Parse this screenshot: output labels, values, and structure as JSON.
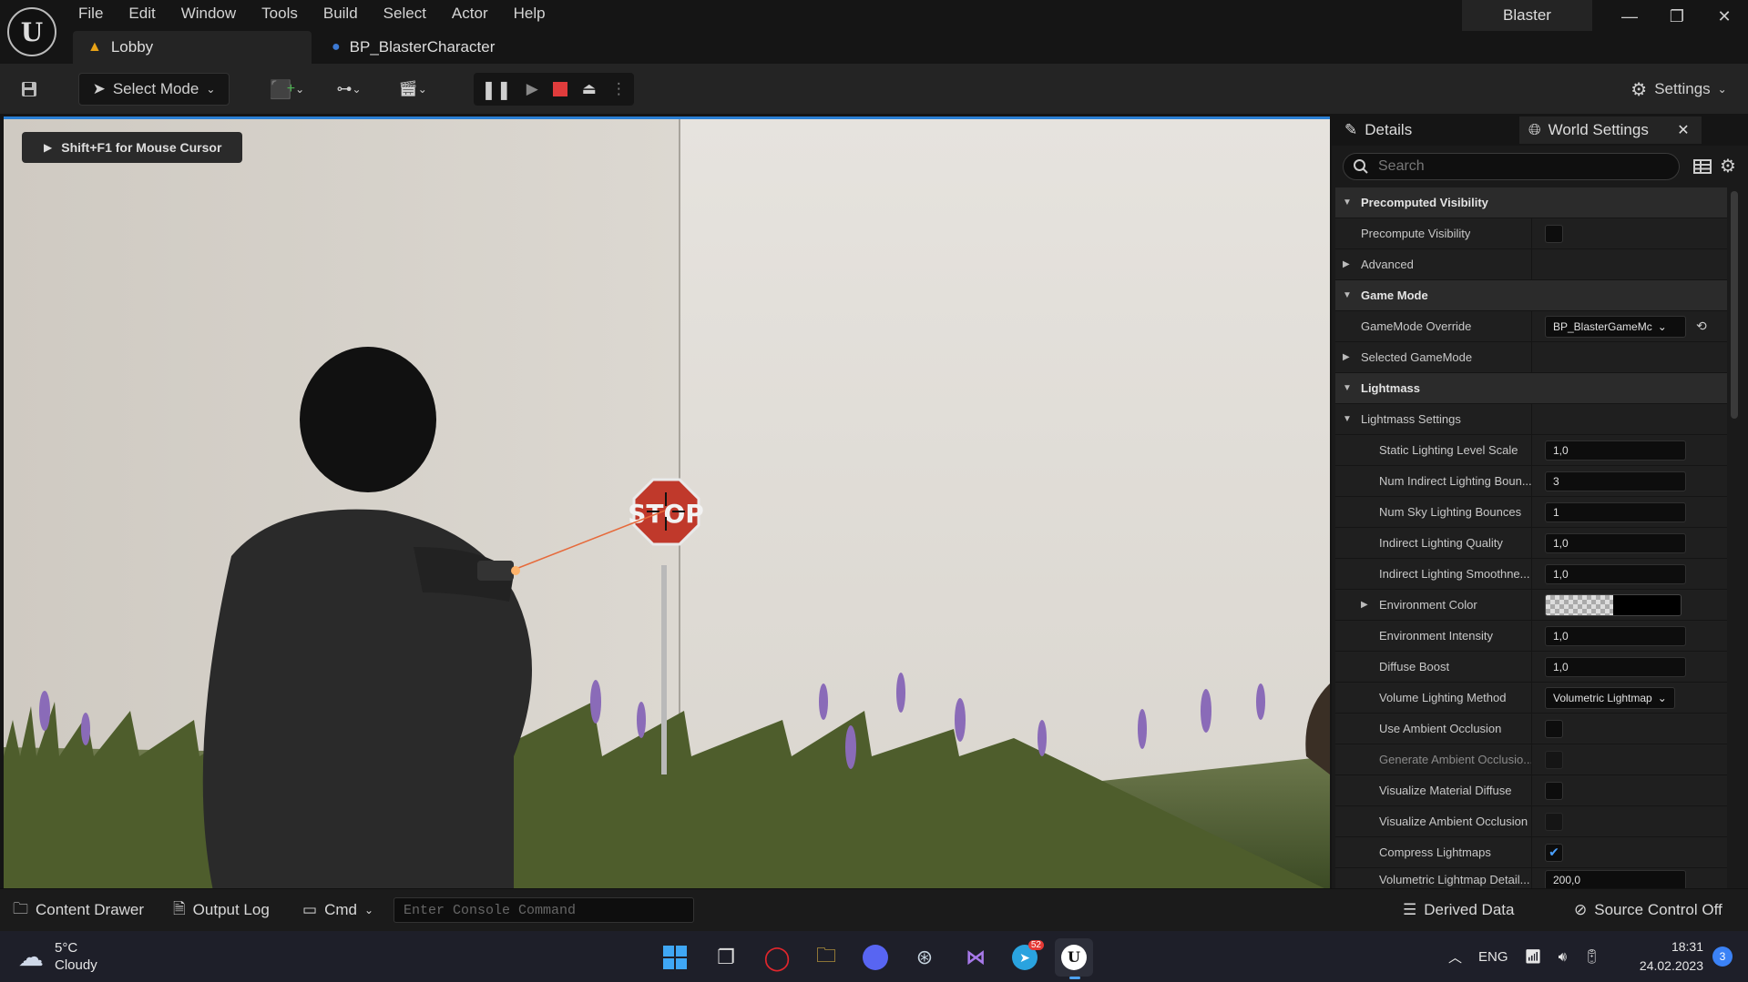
{
  "titlebar": {
    "logo_text": "U",
    "menu": [
      "File",
      "Edit",
      "Window",
      "Tools",
      "Build",
      "Select",
      "Actor",
      "Help"
    ],
    "project_name": "Blaster",
    "tabs": [
      {
        "label": "Lobby",
        "icon": "level-icon"
      },
      {
        "label": "BP_BlasterCharacter",
        "icon": "blueprint-icon"
      }
    ]
  },
  "toolbar": {
    "select_mode_label": "Select Mode",
    "settings_label": "Settings"
  },
  "viewport": {
    "cursor_hint": "Shift+F1 for Mouse Cursor",
    "sign_text": "STOP"
  },
  "details": {
    "tab_details": "Details",
    "tab_world_settings": "World Settings",
    "search_placeholder": "Search",
    "rows": [
      {
        "type": "cat",
        "label": "Precomputed Visibility",
        "expanded": true
      },
      {
        "type": "prop",
        "label": "Precompute Visibility",
        "kind": "checkbox",
        "checked": false
      },
      {
        "type": "prop",
        "label": "Advanced",
        "kind": "group",
        "expanded": false
      },
      {
        "type": "cat",
        "label": "Game Mode",
        "expanded": true
      },
      {
        "type": "prop",
        "label": "GameMode Override",
        "kind": "dropdown",
        "value": "BP_BlasterGameMc"
      },
      {
        "type": "prop",
        "label": "Selected GameMode",
        "kind": "group",
        "expanded": false
      },
      {
        "type": "cat",
        "label": "Lightmass",
        "expanded": true
      },
      {
        "type": "prop",
        "label": "Lightmass Settings",
        "kind": "group",
        "expanded": true
      },
      {
        "type": "sub",
        "label": "Static Lighting Level Scale",
        "kind": "number",
        "value": "1,0"
      },
      {
        "type": "sub",
        "label": "Num Indirect Lighting Boun...",
        "kind": "number",
        "value": "3"
      },
      {
        "type": "sub",
        "label": "Num Sky Lighting Bounces",
        "kind": "number",
        "value": "1"
      },
      {
        "type": "sub",
        "label": "Indirect Lighting Quality",
        "kind": "number",
        "value": "1,0"
      },
      {
        "type": "sub",
        "label": "Indirect Lighting Smoothne...",
        "kind": "number",
        "value": "1,0"
      },
      {
        "type": "sub",
        "label": "Environment Color",
        "kind": "color",
        "expandable": true
      },
      {
        "type": "sub",
        "label": "Environment Intensity",
        "kind": "number",
        "value": "1,0"
      },
      {
        "type": "sub",
        "label": "Diffuse Boost",
        "kind": "number",
        "value": "1,0"
      },
      {
        "type": "sub",
        "label": "Volume Lighting Method",
        "kind": "dropdown",
        "value": "Volumetric Lightmap"
      },
      {
        "type": "sub",
        "label": "Use Ambient Occlusion",
        "kind": "checkbox",
        "checked": false
      },
      {
        "type": "sub",
        "label": "Generate Ambient Occlusio...",
        "kind": "checkbox",
        "checked": false
      },
      {
        "type": "sub",
        "label": "Visualize Material Diffuse",
        "kind": "checkbox",
        "checked": false
      },
      {
        "type": "sub",
        "label": "Visualize Ambient Occlusion",
        "kind": "checkbox",
        "checked": false
      },
      {
        "type": "sub",
        "label": "Compress Lightmaps",
        "kind": "checkbox",
        "checked": true
      },
      {
        "type": "sub",
        "label": "Volumetric Lightmap Detail...",
        "kind": "number",
        "value": "200,0"
      }
    ]
  },
  "bottombar": {
    "content_drawer": "Content Drawer",
    "output_log": "Output Log",
    "cmd": "Cmd",
    "console_placeholder": "Enter Console Command",
    "derived_data": "Derived Data",
    "source_control": "Source Control Off"
  },
  "taskbar": {
    "weather_temp": "5°C",
    "weather_desc": "Cloudy",
    "apps": [
      {
        "name": "windows-start-icon"
      },
      {
        "name": "task-view-icon"
      },
      {
        "name": "opera-icon"
      },
      {
        "name": "file-explorer-icon"
      },
      {
        "name": "discord-icon"
      },
      {
        "name": "steam-icon"
      },
      {
        "name": "visual-studio-icon"
      },
      {
        "name": "telegram-icon",
        "badge": "52"
      },
      {
        "name": "unreal-engine-icon"
      }
    ],
    "language": "ENG",
    "time": "18:31",
    "date": "24.02.2023",
    "notifications": "3"
  },
  "colors": {
    "accent": "#2a7fd4",
    "stop_red": "#c0392b",
    "panel_bg": "#1a1a1a"
  }
}
